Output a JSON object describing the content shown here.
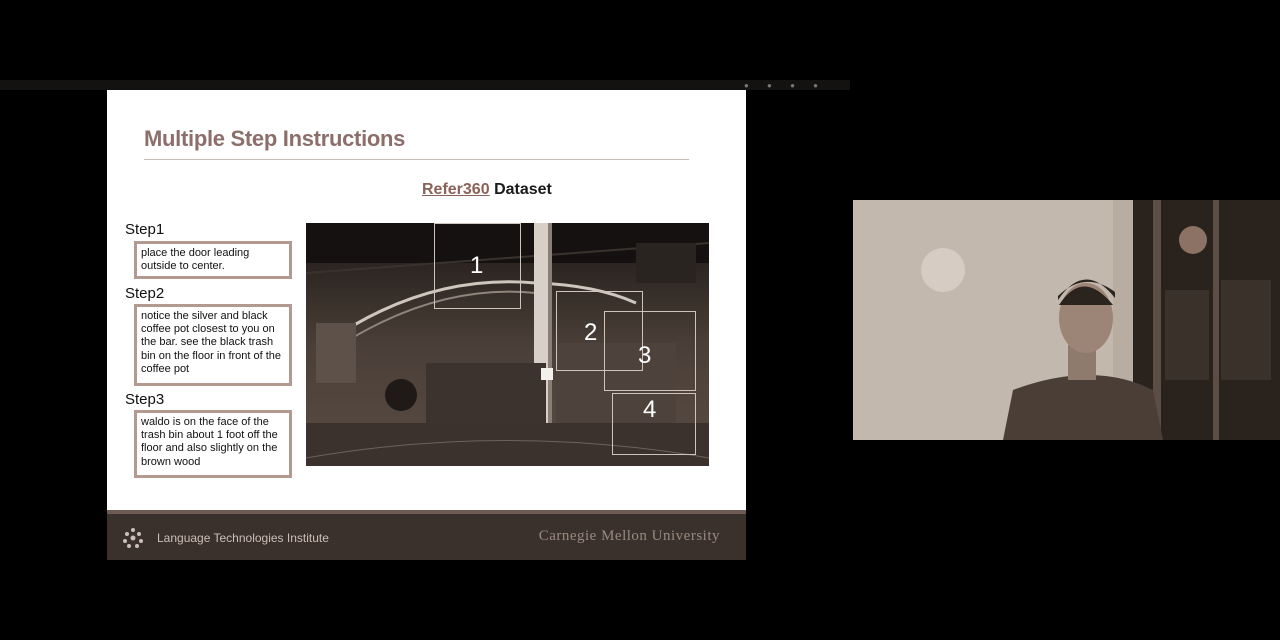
{
  "slide": {
    "title": "Multiple Step Instructions",
    "dataset_link": "Refer360",
    "dataset_word": "Dataset",
    "steps": [
      {
        "label": "Step1",
        "text": "place the door leading outside to center."
      },
      {
        "label": "Step2",
        "text": "notice the silver and black coffee pot closest to you on the bar. see the black trash bin on the floor in front of the coffee pot"
      },
      {
        "label": "Step3",
        "text": "waldo is on the face of the trash bin about 1 foot off the floor and also slightly on the brown wood"
      }
    ],
    "region_numbers": [
      "1",
      "2",
      "3",
      "4"
    ]
  },
  "footer": {
    "institute": "Language Technologies Institute",
    "university": "Carnegie Mellon University"
  },
  "colors": {
    "title": "#8c6f6a",
    "box_border": "#b29a90",
    "footer_bg": "#3a302c"
  }
}
